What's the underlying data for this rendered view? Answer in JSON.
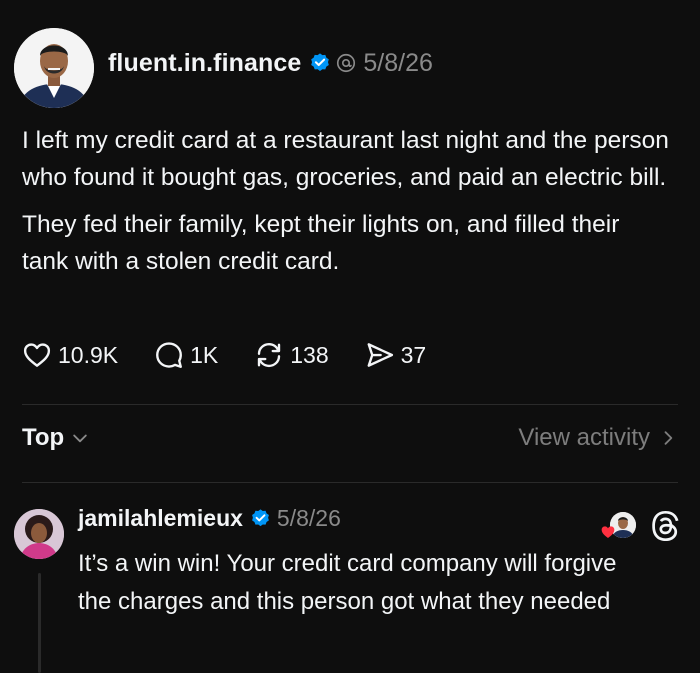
{
  "post": {
    "handle": "fluent.in.finance",
    "date": "5/8/26",
    "paragraphs": [
      "I left my credit card at a restaurant last night and the person who found it bought gas, groceries, and paid an electric bill.",
      "They fed their family, kept their lights on, and filled their tank with a stolen credit card."
    ],
    "stats": {
      "likes": "10.9K",
      "comments": "1K",
      "reposts": "138",
      "shares": "37"
    }
  },
  "sort": {
    "label": "Top",
    "view_activity": "View activity"
  },
  "reply": {
    "handle": "jamilahlemieux",
    "date": "5/8/26",
    "text": "It’s a win win! Your credit card company will forgive the charges and this person got what they needed"
  },
  "colors": {
    "background": "#0e0e0e",
    "verified": "#0095f6",
    "like_heart": "#ff3040",
    "muted": "#8a8a8a"
  },
  "icons": [
    "verified-icon",
    "threads-icon",
    "heart-icon",
    "comment-icon",
    "repost-icon",
    "share-icon",
    "chevron-down-icon",
    "chevron-right-icon"
  ]
}
